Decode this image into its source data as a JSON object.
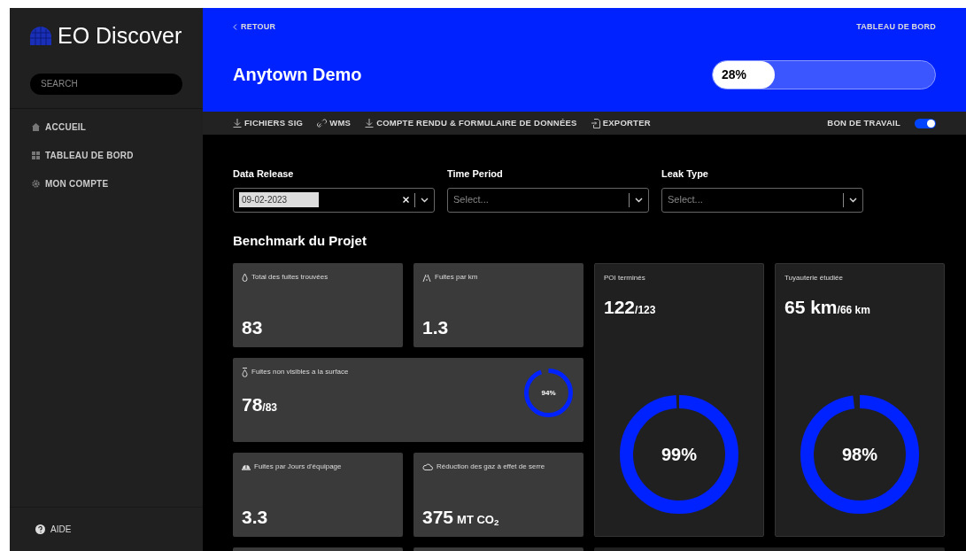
{
  "sidebar": {
    "brand": "EO Discover",
    "search": {
      "placeholder": "SEARCH"
    },
    "items": [
      {
        "label": "ACCUEIL",
        "selected": false
      },
      {
        "label": "TABLEAU DE BORD",
        "selected": false
      },
      {
        "label": "MON COMPTE",
        "selected": false
      }
    ],
    "help": "AIDE"
  },
  "header": {
    "back": "RETOUR",
    "breadcrumb": "TABLEAU DE BORD",
    "title": "Anytown Demo",
    "progress": {
      "reading": "28%",
      "level": 0.28
    }
  },
  "toolbar": {
    "actions": [
      {
        "label": "FICHIERS SIG"
      },
      {
        "label": "WMS"
      },
      {
        "label": "COMPTE RENDU & FORMULAIRE DE DONNÉES"
      },
      {
        "label": "EXPORTER"
      }
    ],
    "toggle": {
      "label": "BON DE TRAVAIL",
      "on": true
    }
  },
  "filters": [
    {
      "label": "Data Release",
      "value": "09-02-2023"
    },
    {
      "label": "Time Period",
      "placeholder": "Select..."
    },
    {
      "label": "Leak Type",
      "placeholder": "Select..."
    }
  ],
  "section_title": "Benchmark du Projet",
  "cards": [
    {
      "kind": "stat",
      "label": "Total des fuites trouvées",
      "value": "83"
    },
    {
      "kind": "stat",
      "label": "Fuites par km",
      "value": "1.3"
    },
    {
      "kind": "tall",
      "label": "POI terminés",
      "value": "122",
      "total": "/123",
      "reading": "99%"
    },
    {
      "kind": "tall",
      "label": "Tuyauterie étudiée",
      "value": "65 km",
      "total": "/66 km",
      "reading": "98%"
    },
    {
      "kind": "wide",
      "label": "Fuites non visibles a la surface",
      "value": "78",
      "total": "/83",
      "reading": "94%"
    },
    {
      "kind": "stat",
      "label": "Fuites par Jours d'équipage",
      "value": "3.3"
    },
    {
      "kind": "stat",
      "label": "Réduction des gaz à effet de serre",
      "value": "375",
      "unit": "MT CO$_{2}$"
    }
  ]
}
